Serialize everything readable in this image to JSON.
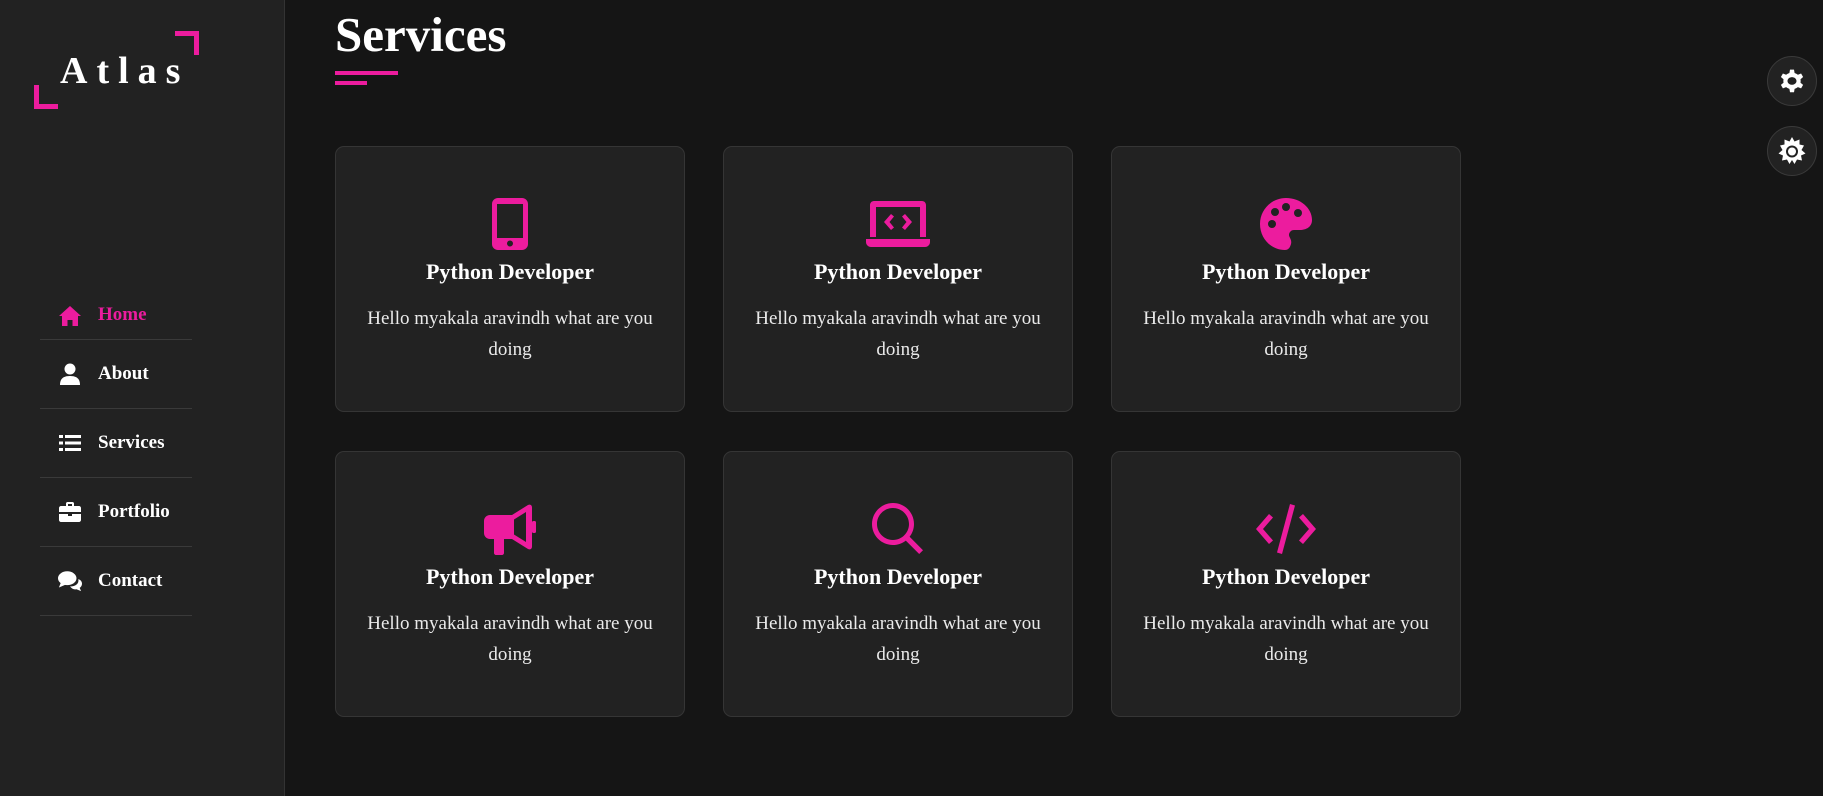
{
  "sidebar": {
    "logo": "Atlas",
    "items": [
      {
        "label": "Home",
        "icon": "home-icon",
        "active": true
      },
      {
        "label": "About",
        "icon": "user-icon",
        "active": false
      },
      {
        "label": "Services",
        "icon": "list-icon",
        "active": false
      },
      {
        "label": "Portfolio",
        "icon": "briefcase-icon",
        "active": false
      },
      {
        "label": "Contact",
        "icon": "comments-icon",
        "active": false
      }
    ]
  },
  "main": {
    "title": "Services",
    "cards": [
      {
        "icon": "mobile-icon",
        "title": "Python Developer",
        "description": "Hello myakala aravindh what are you doing"
      },
      {
        "icon": "laptop-code-icon",
        "title": "Python Developer",
        "description": "Hello myakala aravindh what are you doing"
      },
      {
        "icon": "palette-icon",
        "title": "Python Developer",
        "description": "Hello myakala aravindh what are you doing"
      },
      {
        "icon": "bullhorn-icon",
        "title": "Python Developer",
        "description": "Hello myakala aravindh what are you doing"
      },
      {
        "icon": "search-icon",
        "title": "Python Developer",
        "description": "Hello myakala aravindh what are you doing"
      },
      {
        "icon": "code-icon",
        "title": "Python Developer",
        "description": "Hello myakala aravindh what are you doing"
      }
    ]
  },
  "floating": {
    "settings_icon": "gear-icon",
    "theme_icon": "sun-icon"
  },
  "colors": {
    "accent": "#ec1c9e",
    "background": "#151515",
    "panel": "#222222"
  }
}
